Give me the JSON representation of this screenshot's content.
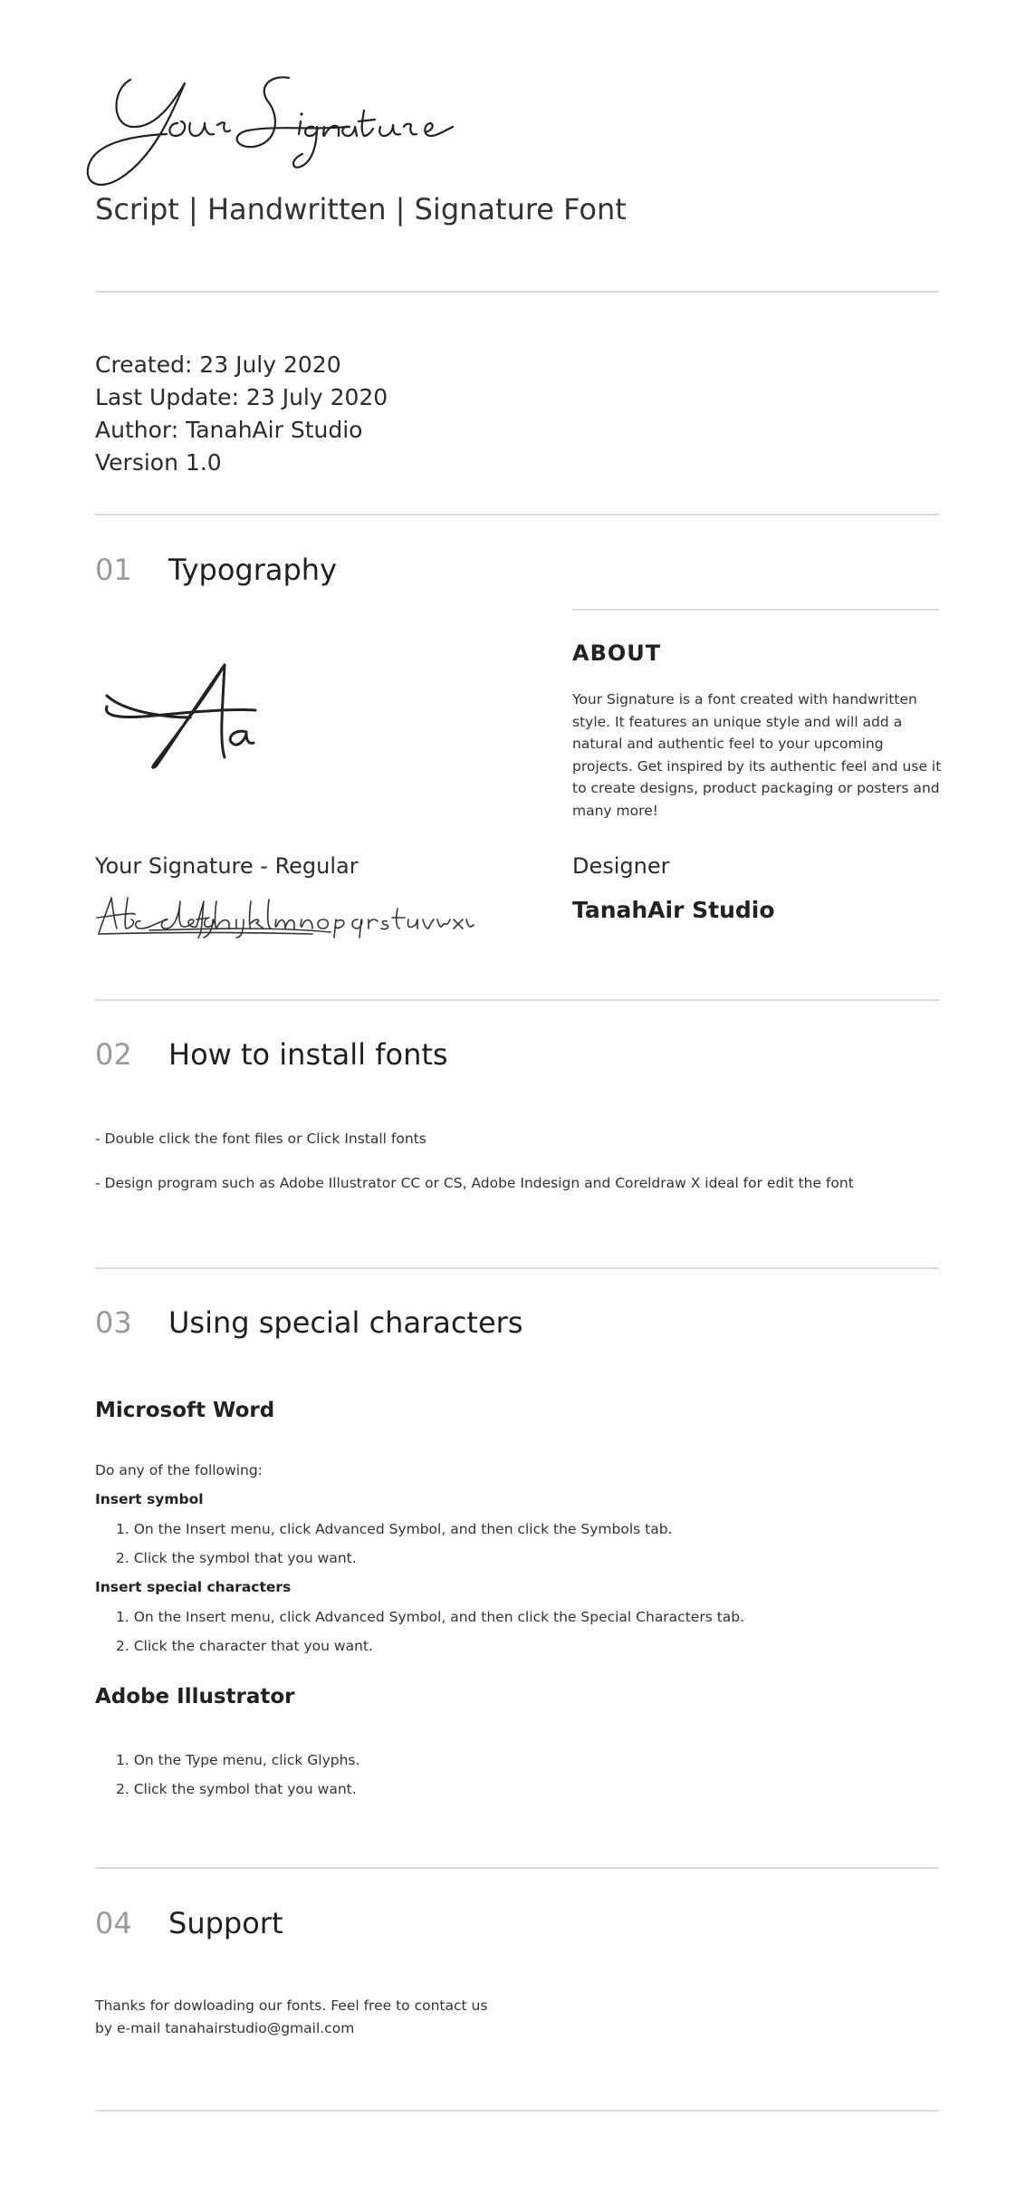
{
  "header": {
    "logo_text": "Your Signature",
    "subtitle": "Script | Handwritten | Signature Font"
  },
  "meta": {
    "created": "Created: 23 July 2020",
    "updated": "Last Update: 23 July 2020",
    "author": "Author: TanahAir Studio",
    "version": "Version 1.0"
  },
  "sections": [
    {
      "num": "01",
      "title": "Typography"
    },
    {
      "num": "02",
      "title": "How to install fonts"
    },
    {
      "num": "03",
      "title": "Using special characters"
    },
    {
      "num": "04",
      "title": "Support"
    }
  ],
  "typography": {
    "specimen_glyphs": "Aa",
    "about_heading": "ABOUT",
    "about_text": "Your Signature is a font created with handwritten style. It features an unique style and will add a natural and authentic feel to your upcoming projects. Get inspired by its authentic feel and use it to create designs, product packaging or posters and many more!",
    "font_name": "Your Signature - Regular",
    "alphabet": "Abcdefghijklmnopqrstuvwxyz",
    "designer_label": "Designer",
    "designer_value": "TanahAir Studio"
  },
  "install": {
    "steps": [
      "- Double click the font files or Click Install fonts",
      "- Design program such as Adobe Illustrator CC or CS, Adobe Indesign and Coreldraw X ideal for edit the font"
    ]
  },
  "special": {
    "word_heading": "Microsoft Word",
    "intro": "Do any of the following:",
    "insert_symbol_heading": "Insert symbol",
    "insert_symbol_steps": [
      "1. On the Insert menu, click Advanced Symbol, and then click the Symbols tab.",
      "2. Click the symbol that you want."
    ],
    "insert_special_heading": "Insert special characters",
    "insert_special_steps": [
      "1. On the Insert menu, click Advanced Symbol, and then click the Special Characters tab.",
      "2. Click the character that you want."
    ],
    "illustrator_heading": "Adobe Illustrator",
    "illustrator_steps": [
      "1. On the Type menu, click Glyphs.",
      "2. Click the symbol that you want."
    ]
  },
  "support": {
    "line1": "Thanks for dowloading our fonts. Feel free to contact us",
    "line2": "by e-mail tanahairstudio@gmail.com"
  }
}
